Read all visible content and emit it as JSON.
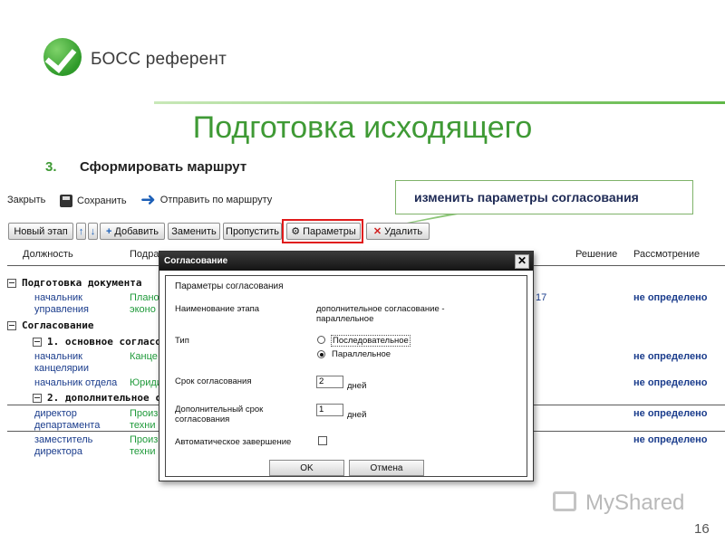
{
  "brand": {
    "name": "БОСС референт"
  },
  "slide": {
    "title": "Подготовка исходящего",
    "step_number": "3.",
    "step_text": "Сформировать маршрут",
    "page_number": "16"
  },
  "callout": {
    "text": "изменить параметры согласования"
  },
  "toolbar_top": {
    "close": "Закрыть",
    "save": "Сохранить",
    "send": "Отправить по маршруту"
  },
  "toolbar_buttons": {
    "new_stage": "Новый этап",
    "up": "↑",
    "down": "↓",
    "add": "Добавить",
    "replace": "Заменить",
    "skip": "Пропустить",
    "params": "Параметры",
    "delete": "Удалить"
  },
  "table": {
    "headers": {
      "position": "Должность",
      "dept": "Подра",
      "decision": "Решение",
      "review": "Рассмотрение"
    },
    "group1": "Подготовка документа",
    "row1": {
      "position": "начальник управления",
      "dept": "Плано эконо",
      "date_frag": "17",
      "status": "не определено"
    },
    "group2": "Согласование",
    "sub1": "1. основное согласо",
    "row2": {
      "position": "начальник канцелярии",
      "dept": "Канце",
      "status": "не определено"
    },
    "row3": {
      "position": "начальник отдела",
      "dept": "Юриди",
      "status": "не определено"
    },
    "sub2": "2. дополнительное с",
    "row4": {
      "position": "директор департамента",
      "dept": "Произ техни",
      "status": "не определено"
    },
    "row5": {
      "position": "заместитель директора",
      "dept": "Произ техни",
      "status": "не определено"
    }
  },
  "dialog": {
    "title": "Согласование",
    "close": "✕",
    "section": "Параметры согласования",
    "stage_name_label": "Наименование этапа",
    "stage_name_value": "дополнительное согласование - параллельное",
    "type_label": "Тип",
    "type_options": [
      "Последовательное",
      "Параллельное"
    ],
    "type_selected": "Параллельное",
    "term_label": "Срок согласования",
    "term_value": "2",
    "term_unit": "дней",
    "extra_term_label": "Дополнительный срок согласования",
    "extra_term_value": "1",
    "extra_term_unit": "дней",
    "auto_finish_label": "Автоматическое завершение",
    "auto_finish_checked": false,
    "ok": "OK",
    "cancel": "Отмена"
  },
  "watermark": {
    "text": "MyShared"
  },
  "colors": {
    "accent_green": "#3f9a35",
    "highlight_red": "#e01a1a",
    "link_blue": "#1a3c8c"
  }
}
